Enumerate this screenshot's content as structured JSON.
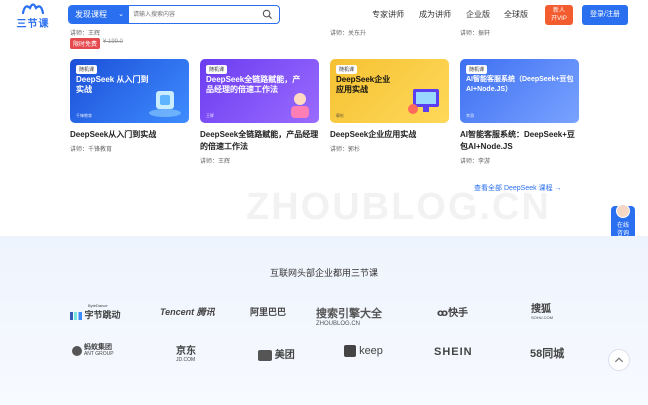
{
  "header": {
    "logo_text": "三节课",
    "search_category": "发现课程",
    "search_placeholder": "请输入搜索内容",
    "nav": [
      "专家讲师",
      "成为讲师",
      "企业版",
      "全球版"
    ],
    "vip_line1": "新人",
    "vip_line2": "开VIP",
    "login_label": "登录/注册"
  },
  "prev_row": {
    "col1_lecturer": "讲师：王辉",
    "col3_lecturer": "讲师：关东升",
    "col4_lecturer": "讲师：振轩",
    "free_badge": "限时免费",
    "old_price": "¥ 199.0"
  },
  "cards": [
    {
      "tag": "随机课",
      "img_title": "DeepSeek 从入门到实战",
      "brand": "千锋教育",
      "title": "DeepSeek从入门到实战",
      "lecturer": "讲师：千锋教育",
      "bg": "#1f5fe0"
    },
    {
      "tag": "随机课",
      "img_title": "DeepSeek全链路赋能，产品经理的倍速工作法",
      "brand": "王辉",
      "title": "DeepSeek全链路赋能，产品经理的倍速工作法",
      "lecturer": "讲师：王辉",
      "bg": "#7b4df0"
    },
    {
      "tag": "随机课",
      "img_title": "DeepSeek企业应用实战",
      "brand": "郭杉",
      "title": "DeepSeek企业应用实战",
      "lecturer": "讲师：郭杉",
      "bg": "#f7c531"
    },
    {
      "tag": "随机课",
      "img_title": "AI智能客服系统（DeepSeek+豆包AI+Node.JS）",
      "brand": "李游",
      "title": "AI智能客服系统：DeepSeek+豆包AI+Node.JS",
      "lecturer": "讲师：李游",
      "bg": "#4a7cf5"
    }
  ],
  "view_all": "查看全部 DeepSeek 课程  →",
  "watermark": "ZHOUBLOG.CN",
  "consult": {
    "line1": "在线",
    "line2": "咨询"
  },
  "partners": {
    "title": "互联网头部企业都用三节课",
    "row1": [
      "字节跳动",
      "Tencent 腾讯",
      "阿里巴巴",
      "搜索引擎大全",
      "快手",
      "搜狐"
    ],
    "row2": [
      "蚂蚁集团",
      "京东",
      "美团",
      "keep",
      "SHEIN",
      "58同城"
    ],
    "bytedance_small": "ByteDance",
    "sohu_small": "SOHU.COM",
    "ant_small": "ANT GROUP",
    "jd_small": "JD.COM",
    "wm_small": "ZHOUBLOG.CN"
  }
}
